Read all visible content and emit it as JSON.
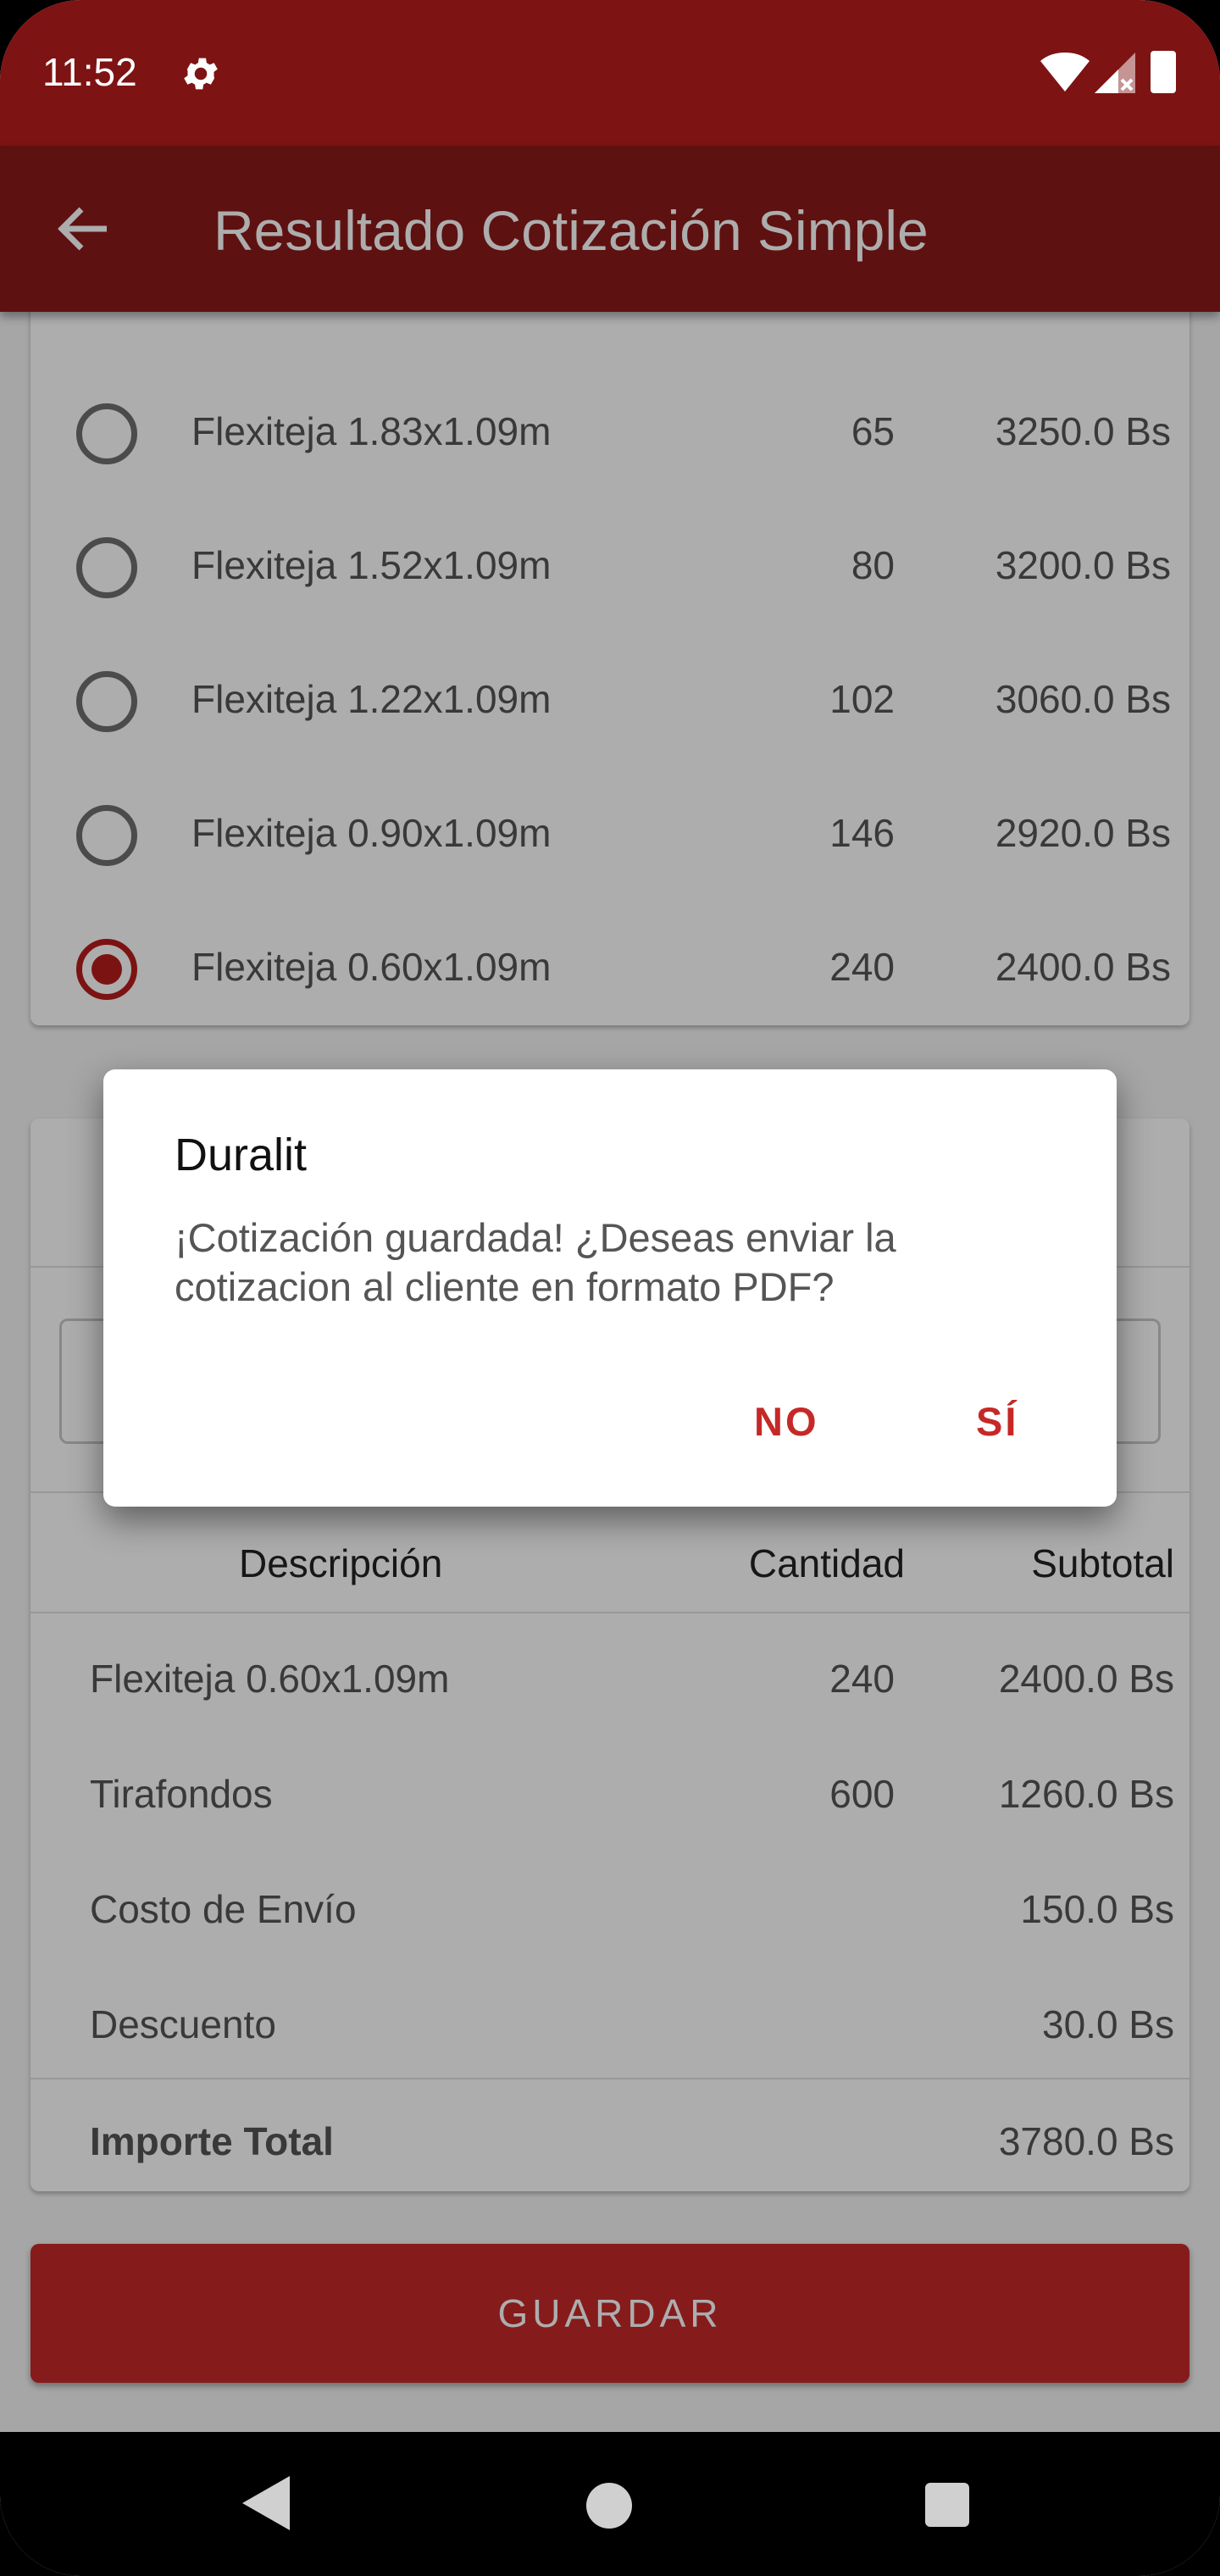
{
  "status_bar": {
    "time": "11:52",
    "icons": [
      "gear-icon",
      "wifi-icon",
      "signal-icon",
      "battery-icon"
    ]
  },
  "app_bar": {
    "title": "Resultado Cotización Simple",
    "back_icon": "arrow-back-icon",
    "color": "#8b1a1a"
  },
  "options": [
    {
      "name": "Flexiteja 1.83x1.09m",
      "qty": "65",
      "price": "3250.0 Bs",
      "selected": false
    },
    {
      "name": "Flexiteja 1.52x1.09m",
      "qty": "80",
      "price": "3200.0 Bs",
      "selected": false
    },
    {
      "name": "Flexiteja 1.22x1.09m",
      "qty": "102",
      "price": "3060.0 Bs",
      "selected": false
    },
    {
      "name": "Flexiteja 0.90x1.09m",
      "qty": "146",
      "price": "2920.0 Bs",
      "selected": false
    },
    {
      "name": "Flexiteja 0.60x1.09m",
      "qty": "240",
      "price": "2400.0 Bs",
      "selected": true
    }
  ],
  "summary": {
    "headers": {
      "description": "Descripción",
      "quantity": "Cantidad",
      "subtotal": "Subtotal"
    },
    "rows": [
      {
        "description": "Flexiteja 0.60x1.09m",
        "quantity": "240",
        "subtotal": "2400.0 Bs"
      },
      {
        "description": "Tirafondos",
        "quantity": "600",
        "subtotal": "1260.0 Bs"
      },
      {
        "description": "Costo de Envío",
        "quantity": "",
        "subtotal": "150.0 Bs"
      },
      {
        "description": "Descuento",
        "quantity": "",
        "subtotal": "30.0 Bs"
      }
    ],
    "total": {
      "label": "Importe Total",
      "value": "3780.0 Bs"
    }
  },
  "save_button": {
    "label": "GUARDAR",
    "color": "#c62828"
  },
  "dialog": {
    "title": "Duralit",
    "message": "¡Cotización guardada! ¿Deseas enviar la cotizacion al cliente en formato PDF?",
    "no_label": "NO",
    "yes_label": "SÍ"
  },
  "nav_bar": {
    "icons": [
      "nav-back-icon",
      "nav-home-icon",
      "nav-recents-icon"
    ]
  }
}
